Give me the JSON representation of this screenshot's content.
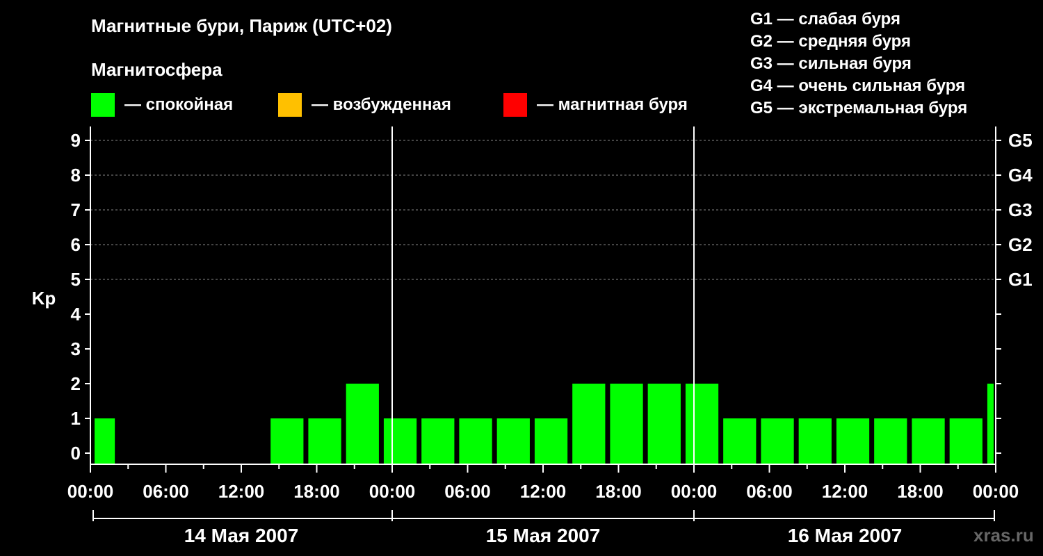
{
  "title": "Магнитные бури, Париж (UTC+02)",
  "magnetosphere_heading": "Магнитосфера",
  "legend": [
    {
      "color": "#00ff00",
      "label": "— спокойная"
    },
    {
      "color": "#ffc000",
      "label": "— возбужденная"
    },
    {
      "color": "#ff0000",
      "label": "— магнитная буря"
    }
  ],
  "g_scale_legend": [
    "G1 — слабая буря",
    "G2 — средняя буря",
    "G3 — сильная буря",
    "G4 — очень сильная буря",
    "G5 — экстремальная буря"
  ],
  "watermark": "xras.ru",
  "chart_data": {
    "type": "bar",
    "title": "Магнитные бури, Париж (UTC+02)",
    "ylabel": "Kp",
    "ylim": [
      0,
      9
    ],
    "y_ticks": [
      "0",
      "1",
      "2",
      "3",
      "4",
      "5",
      "6",
      "7",
      "8",
      "9"
    ],
    "right_axis_labels": [
      {
        "kp": 5,
        "label": "G1"
      },
      {
        "kp": 6,
        "label": "G2"
      },
      {
        "kp": 7,
        "label": "G3"
      },
      {
        "kp": 8,
        "label": "G4"
      },
      {
        "kp": 9,
        "label": "G5"
      }
    ],
    "x_tick_labels": [
      "00:00",
      "06:00",
      "12:00",
      "18:00",
      "00:00",
      "06:00",
      "12:00",
      "18:00",
      "00:00",
      "06:00",
      "12:00",
      "18:00",
      "00:00"
    ],
    "days": [
      "14 Мая 2007",
      "15 Мая 2007",
      "16 Мая 2007"
    ],
    "grid": "dashed horizontal at Kp 5–9",
    "bars": [
      {
        "start": "14 Мая 2007 00:00",
        "end": "14 Мая 2007 02:00",
        "kp": 1,
        "color": "#00ff00"
      },
      {
        "start": "14 Мая 2007 14:00",
        "end": "14 Мая 2007 17:00",
        "kp": 1,
        "color": "#00ff00"
      },
      {
        "start": "14 Мая 2007 17:00",
        "end": "14 Мая 2007 20:00",
        "kp": 1,
        "color": "#00ff00"
      },
      {
        "start": "14 Мая 2007 20:00",
        "end": "14 Мая 2007 23:00",
        "kp": 2,
        "color": "#00ff00"
      },
      {
        "start": "14 Мая 2007 23:00",
        "end": "15 Мая 2007 02:00",
        "kp": 1,
        "color": "#00ff00"
      },
      {
        "start": "15 Мая 2007 02:00",
        "end": "15 Мая 2007 05:00",
        "kp": 1,
        "color": "#00ff00"
      },
      {
        "start": "15 Мая 2007 05:00",
        "end": "15 Мая 2007 08:00",
        "kp": 1,
        "color": "#00ff00"
      },
      {
        "start": "15 Мая 2007 08:00",
        "end": "15 Мая 2007 11:00",
        "kp": 1,
        "color": "#00ff00"
      },
      {
        "start": "15 Мая 2007 11:00",
        "end": "15 Мая 2007 14:00",
        "kp": 1,
        "color": "#00ff00"
      },
      {
        "start": "15 Мая 2007 14:00",
        "end": "15 Мая 2007 17:00",
        "kp": 2,
        "color": "#00ff00"
      },
      {
        "start": "15 Мая 2007 17:00",
        "end": "15 Мая 2007 20:00",
        "kp": 2,
        "color": "#00ff00"
      },
      {
        "start": "15 Мая 2007 20:00",
        "end": "15 Мая 2007 23:00",
        "kp": 2,
        "color": "#00ff00"
      },
      {
        "start": "15 Мая 2007 23:00",
        "end": "16 Мая 2007 02:00",
        "kp": 2,
        "color": "#00ff00"
      },
      {
        "start": "16 Мая 2007 02:00",
        "end": "16 Мая 2007 05:00",
        "kp": 1,
        "color": "#00ff00"
      },
      {
        "start": "16 Мая 2007 05:00",
        "end": "16 Мая 2007 08:00",
        "kp": 1,
        "color": "#00ff00"
      },
      {
        "start": "16 Мая 2007 08:00",
        "end": "16 Мая 2007 11:00",
        "kp": 1,
        "color": "#00ff00"
      },
      {
        "start": "16 Мая 2007 11:00",
        "end": "16 Мая 2007 14:00",
        "kp": 1,
        "color": "#00ff00"
      },
      {
        "start": "16 Мая 2007 14:00",
        "end": "16 Мая 2007 17:00",
        "kp": 1,
        "color": "#00ff00"
      },
      {
        "start": "16 Мая 2007 17:00",
        "end": "16 Мая 2007 20:00",
        "kp": 1,
        "color": "#00ff00"
      },
      {
        "start": "16 Мая 2007 20:00",
        "end": "16 Мая 2007 23:00",
        "kp": 1,
        "color": "#00ff00"
      },
      {
        "start": "16 Мая 2007 23:00",
        "end": "17 Мая 2007 00:00",
        "kp": 2,
        "color": "#00ff00"
      }
    ]
  }
}
